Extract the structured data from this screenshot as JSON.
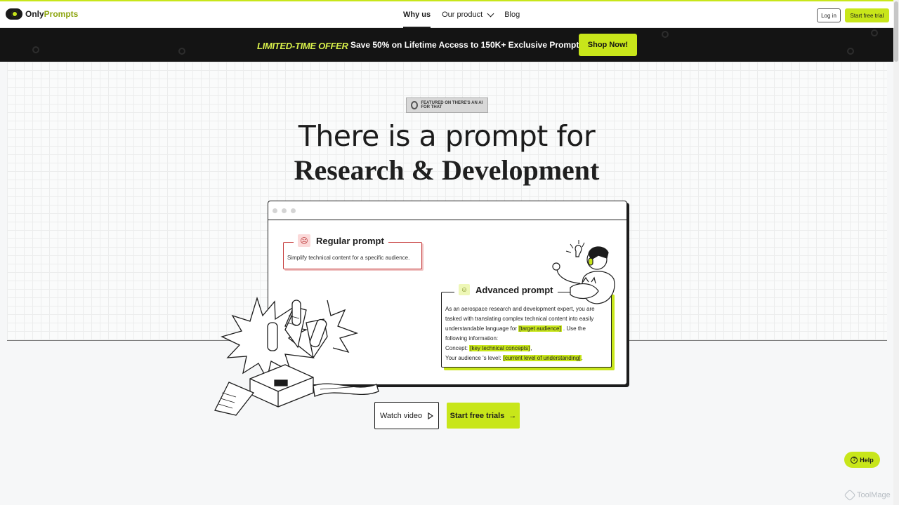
{
  "brand": {
    "part1": "Only",
    "part2": "Prompts",
    "accent": "#c8e61a"
  },
  "nav": {
    "items": [
      {
        "label": "Why us",
        "active": true
      },
      {
        "label": "Our product",
        "dropdown": true
      },
      {
        "label": "Blog"
      }
    ],
    "login": "Log in",
    "trial": "Start free trial"
  },
  "banner": {
    "tag": "LIMITED-TIME OFFER",
    "text": "Save 50% on Lifetime Access to 150K+ Exclusive Prompts!",
    "cta": "Shop Now!"
  },
  "featured_badge": "FEATURED ON THERE'S AN AI FOR THAT",
  "hero": {
    "line1": "There is a prompt for",
    "line2": "Research & Development"
  },
  "regular_prompt": {
    "title": "Regular prompt",
    "icon": "sad-face-icon",
    "text": "Simplify technical content for a specific audience."
  },
  "advanced_prompt": {
    "title": "Advanced prompt",
    "icon": "smile-face-icon",
    "text_part1": "As an aerospace research and development expert, you are tasked with translating complex technical content into easily understandable language for ",
    "var1": "[target audience]",
    "text_part2": " . Use the following information:",
    "concept_label": "Concept: ",
    "var2": "[key technical concepts]",
    "level_label": "Your audience 's level: ",
    "var3": "[current level of understanding]"
  },
  "cta": {
    "watch": "Watch video",
    "start": "Start free trials"
  },
  "help": "Help",
  "watermark": "ToolMage"
}
